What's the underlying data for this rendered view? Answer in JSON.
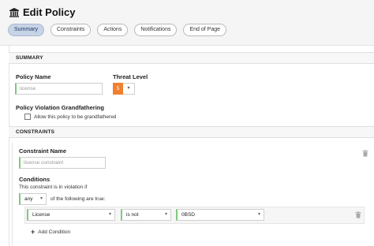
{
  "header": {
    "title": "Edit Policy",
    "tabs": [
      {
        "label": "Summary",
        "active": true
      },
      {
        "label": "Constraints",
        "active": false
      },
      {
        "label": "Actions",
        "active": false
      },
      {
        "label": "Notifications",
        "active": false
      },
      {
        "label": "End of Page",
        "active": false
      }
    ]
  },
  "summary": {
    "section_title": "SUMMARY",
    "policy_name_label": "Policy Name",
    "policy_name_value": "license",
    "threat_level_label": "Threat Level",
    "threat_level_value": "5",
    "threat_level_color": "#f08030",
    "grandfathering_label": "Policy Violation Grandfathering",
    "grandfathering_checkbox_label": "Allow this policy to be grandfathered",
    "grandfathering_checked": false
  },
  "constraints": {
    "section_title": "CONSTRAINTS",
    "constraint_name_label": "Constraint Name",
    "constraint_name_value": "license constraint",
    "conditions_label": "Conditions",
    "violation_intro": "This constraint is in violation if",
    "match_operator": "any",
    "match_suffix": "of the following are true:",
    "conditions": [
      {
        "field": "License",
        "operator": "is not",
        "value": "0BSD"
      }
    ],
    "add_condition_label": "Add Condition"
  },
  "icons": {
    "title_icon": "building-icon",
    "delete_icon": "trash-icon",
    "add_icon": "plus-icon",
    "caret_icon": "chevron-down-icon"
  },
  "colors": {
    "active_tab_bg": "#c7d3e6",
    "required_field_accent": "#7fc97f"
  }
}
